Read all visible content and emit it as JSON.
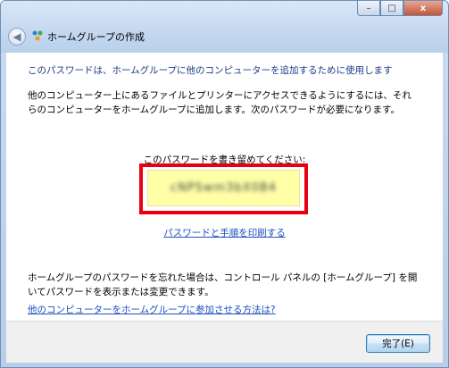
{
  "window": {
    "title": "ホームグループの作成",
    "caption": {
      "minimize": "–",
      "maximize": "□",
      "close": "x"
    }
  },
  "main": {
    "heading": "このパスワードは、ホームグループに他のコンピューターを追加するために使用します",
    "description": "他のコンピューター上にあるファイルとプリンターにアクセスできるようにするには、それらのコンピューターをホームグループに追加します。次のパスワードが必要になります。",
    "password_label": "このパスワードを書き留めてください:",
    "password_value": "cNPSwm3bX0B4",
    "print_link": "パスワードと手順を印刷する",
    "forgot_text": "ホームグループのパスワードを忘れた場合は、コントロール パネルの [ホームグループ] を開いてパスワードを表示または変更できます。",
    "join_link": "他のコンピューターをホームグループに参加させる方法は?"
  },
  "footer": {
    "finish_button": "完了(E)"
  },
  "colors": {
    "highlight_border": "#e60012",
    "password_background": "#ffffa8",
    "link": "#1e4fbf",
    "heading": "#1e3a8a"
  },
  "icons": {
    "back": "back-arrow-icon",
    "title": "homegroup-icon"
  }
}
